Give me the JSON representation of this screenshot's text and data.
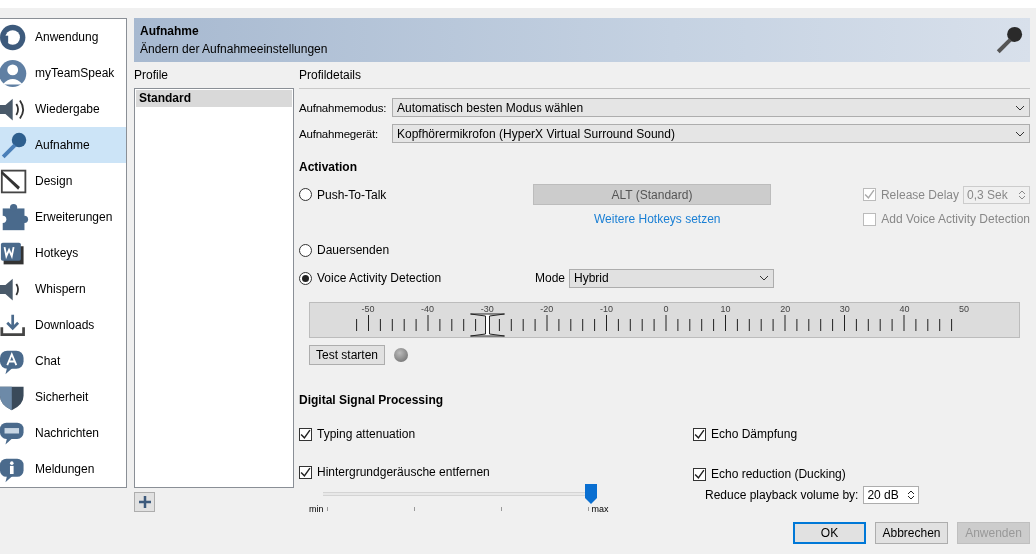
{
  "sidebar": {
    "items": [
      {
        "label": "Anwendung",
        "selected": false
      },
      {
        "label": "myTeamSpeak",
        "selected": false
      },
      {
        "label": "Wiedergabe",
        "selected": false
      },
      {
        "label": "Aufnahme",
        "selected": true
      },
      {
        "label": "Design",
        "selected": false
      },
      {
        "label": "Erweiterungen",
        "selected": false
      },
      {
        "label": "Hotkeys",
        "selected": false
      },
      {
        "label": "Whispern",
        "selected": false
      },
      {
        "label": "Downloads",
        "selected": false
      },
      {
        "label": "Chat",
        "selected": false
      },
      {
        "label": "Sicherheit",
        "selected": false
      },
      {
        "label": "Nachrichten",
        "selected": false
      },
      {
        "label": "Meldungen",
        "selected": false
      }
    ]
  },
  "header": {
    "title": "Aufnahme",
    "subtitle": "Ändern der Aufnahmeeinstellungen"
  },
  "profiles": {
    "label": "Profile",
    "items": [
      {
        "name": "Standard",
        "selected": true
      }
    ]
  },
  "details": {
    "label": "Profildetails",
    "fields": [
      {
        "label": "Aufnahmemodus:",
        "value": "Automatisch besten Modus wählen"
      },
      {
        "label": "Aufnahmegerät:",
        "value": "Kopfhörermikrofon (HyperX Virtual Surround Sound)"
      }
    ],
    "activation": {
      "title": "Activation",
      "push_to_talk": {
        "label": "Push-To-Talk",
        "selected": false,
        "hotkey": "ALT (Standard)",
        "link": "Weitere Hotkeys setzen",
        "release_delay": {
          "label": "Release Delay",
          "checked": true,
          "disabled": true,
          "value": "0,3 Sek"
        },
        "add_vad": {
          "label": "Add Voice Activity Detection",
          "checked": false,
          "disabled": true
        }
      },
      "continuous": {
        "label": "Dauersenden",
        "selected": false
      },
      "vad": {
        "label": "Voice Activity Detection",
        "selected": true,
        "mode_label": "Mode",
        "mode": "Hybrid"
      },
      "meter": {
        "ticks": [
          "-50",
          "-40",
          "-30",
          "-20",
          "-10",
          "0",
          "10",
          "20",
          "30",
          "40",
          "50"
        ],
        "level": 0.2
      },
      "test_button": "Test starten"
    },
    "dsp": {
      "title": "Digital Signal Processing",
      "typing": {
        "label": "Typing attenuation",
        "checked": true
      },
      "echo_damping": {
        "label": "Echo Dämpfung",
        "checked": true
      },
      "noise": {
        "label": "Hintergrundgeräusche entfernen",
        "checked": true,
        "level": 1,
        "min": "min",
        "max": "max"
      },
      "ducking": {
        "label": "Echo reduction (Ducking)",
        "checked": true,
        "volume_label": "Reduce playback volume by:",
        "volume": "20 dB"
      }
    }
  },
  "buttons": [
    {
      "label": "OK",
      "kind": "default"
    },
    {
      "label": "Abbrechen",
      "kind": "normal"
    },
    {
      "label": "Anwenden",
      "kind": "disabled"
    }
  ]
}
